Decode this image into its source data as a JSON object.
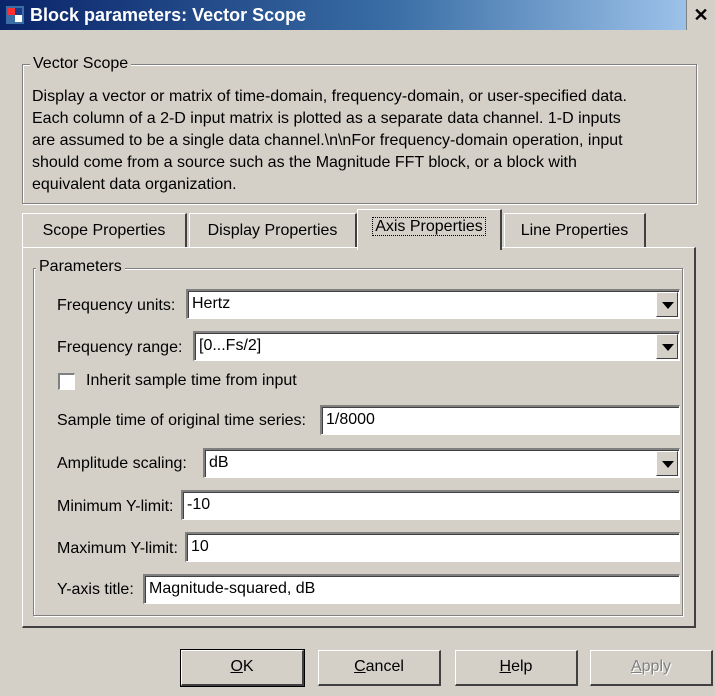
{
  "window": {
    "title": "Block parameters: Vector Scope",
    "close_glyph": "✕"
  },
  "block": {
    "group_title": "Vector Scope",
    "description": [
      "Display a vector or matrix of time-domain, frequency-domain, or user-specified data.",
      "Each column of a 2-D input matrix is plotted as a separate data channel.  1-D inputs",
      "are assumed to be a single data channel.\\n\\nFor frequency-domain operation, input",
      "should come from a source such as the Magnitude FFT block, or a block with",
      "equivalent data organization."
    ]
  },
  "tabs": [
    {
      "label": "Scope Properties",
      "active": false
    },
    {
      "label": "Display Properties",
      "active": false
    },
    {
      "label": "Axis Properties",
      "active": true
    },
    {
      "label": "Line Properties",
      "active": false
    }
  ],
  "parameters": {
    "group_title": "Parameters",
    "frequency_units": {
      "label": "Frequency units:",
      "value": "Hertz"
    },
    "frequency_range": {
      "label": "Frequency range:",
      "value": "[0...Fs/2]"
    },
    "inherit_sample_time": {
      "label": "Inherit sample time from input",
      "checked": false
    },
    "sample_time": {
      "label": "Sample time of original time series:",
      "value": "1/8000"
    },
    "amplitude_scaling": {
      "label": "Amplitude scaling:",
      "value": "dB"
    },
    "min_ylimit": {
      "label": "Minimum Y-limit:",
      "value": "-10"
    },
    "max_ylimit": {
      "label": "Maximum Y-limit:",
      "value": "10"
    },
    "yaxis_title": {
      "label": "Y-axis title:",
      "value": "Magnitude-squared, dB"
    }
  },
  "buttons": {
    "ok": {
      "mnemonic": "O",
      "rest": "K"
    },
    "cancel": {
      "mnemonic": "C",
      "rest": "ancel"
    },
    "help": {
      "mnemonic": "H",
      "rest": "elp"
    },
    "apply": {
      "mnemonic": "A",
      "rest": "pply",
      "enabled": false
    }
  },
  "colors": {
    "titlebar_start": "#0a246a",
    "titlebar_end": "#a6caf0",
    "dialog_face": "#d4d0c8"
  }
}
